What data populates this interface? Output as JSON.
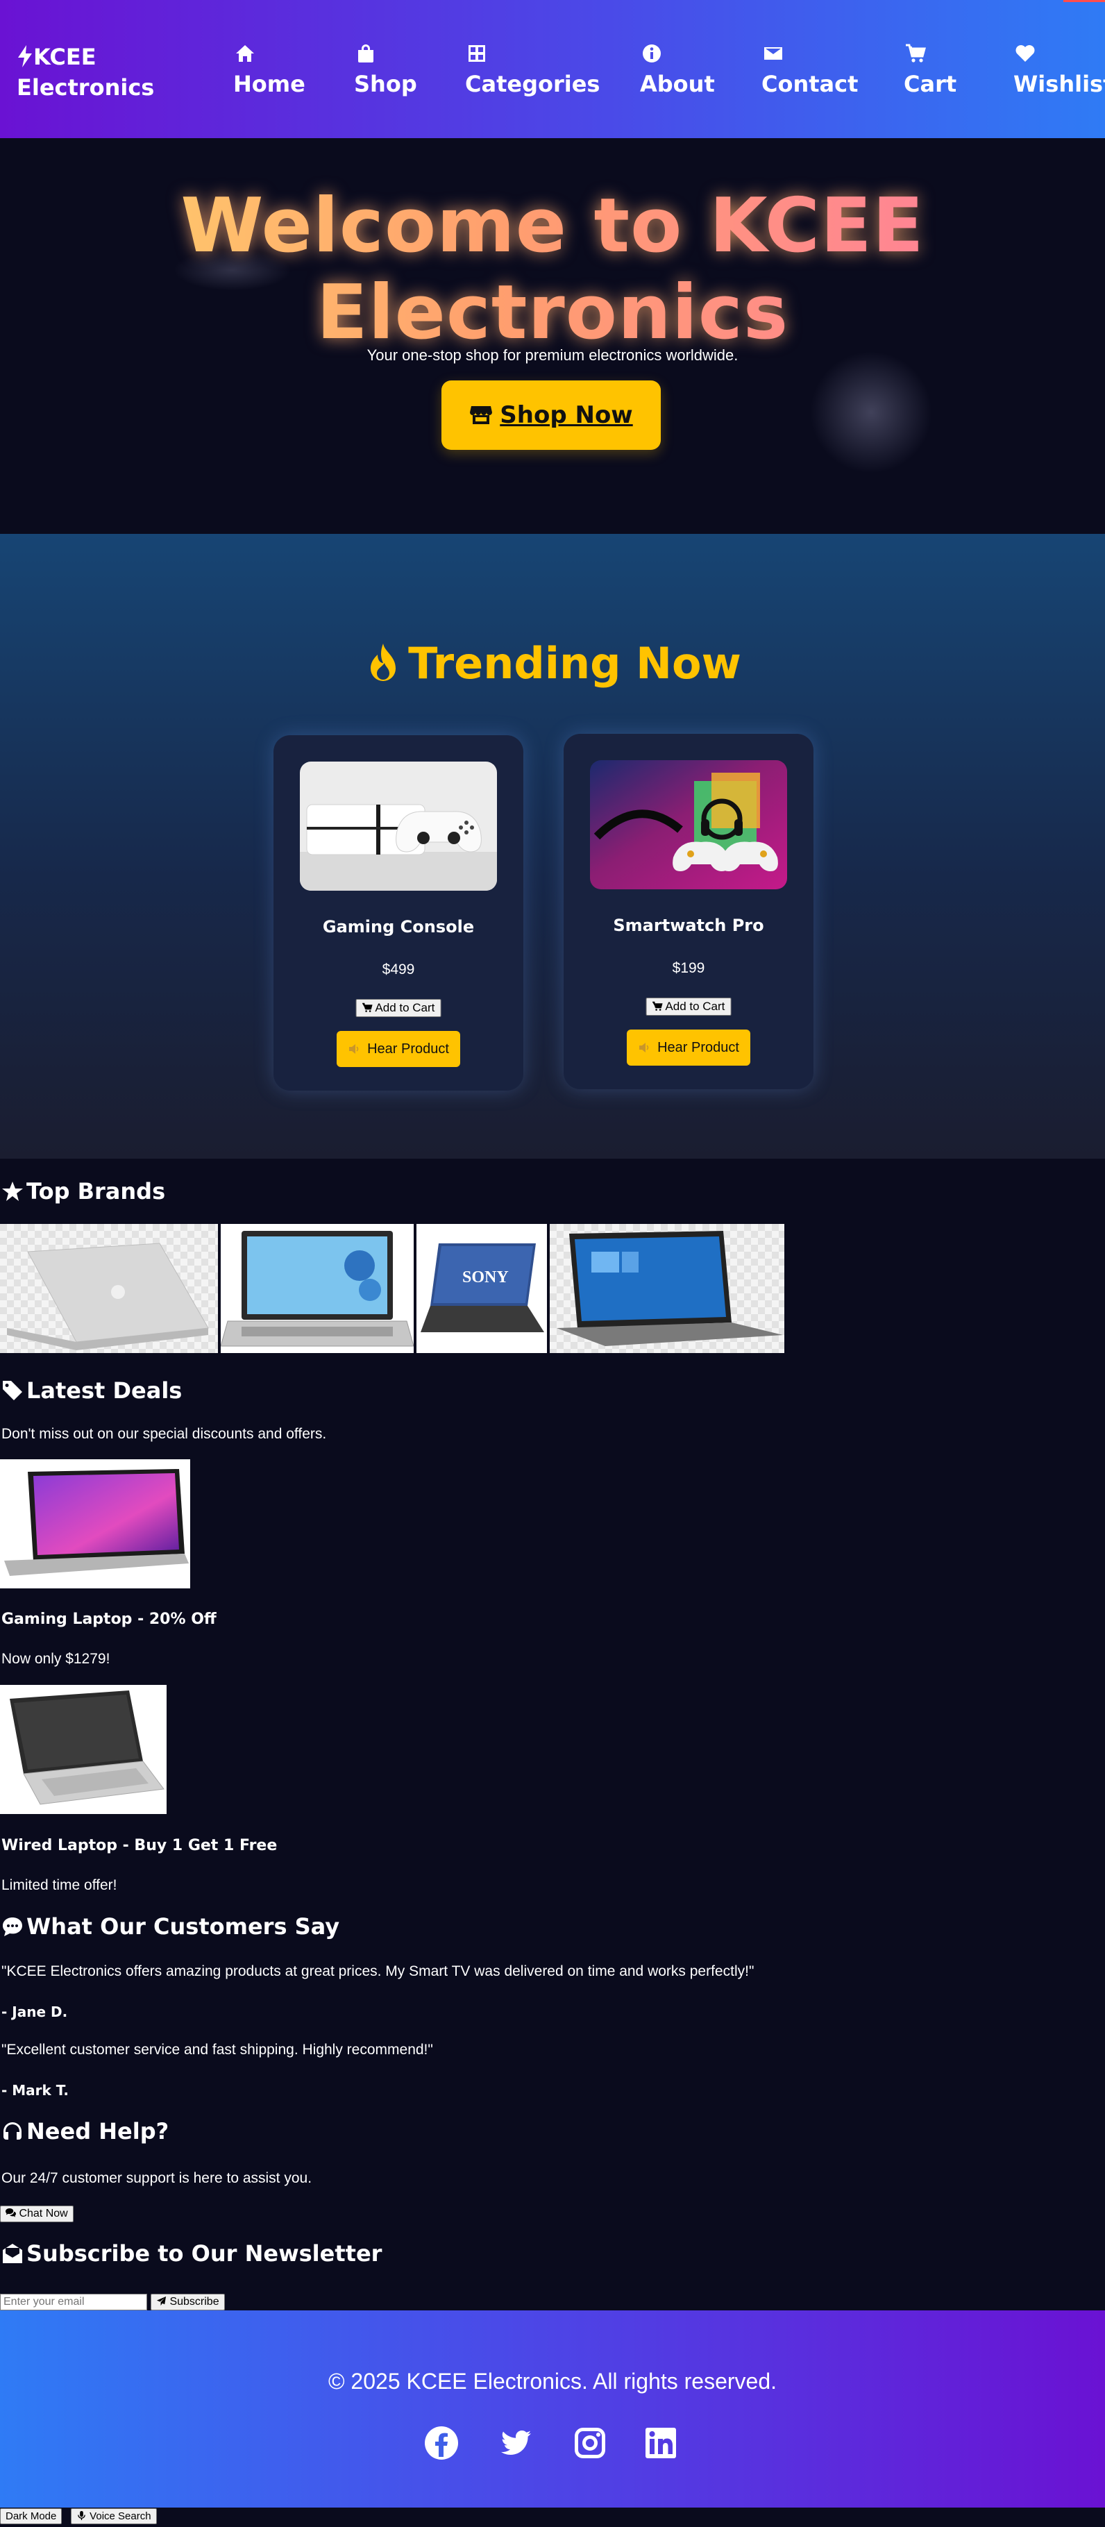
{
  "nav": {
    "brand_line1": "KCEE",
    "brand_line2": "Electronics",
    "items": [
      {
        "label": "Home",
        "icon": "home-icon"
      },
      {
        "label": "Shop",
        "icon": "shopping-bag-icon"
      },
      {
        "label": "Categories",
        "icon": "grid-icon"
      },
      {
        "label": "About",
        "icon": "info-icon"
      },
      {
        "label": "Contact",
        "icon": "envelope-icon"
      },
      {
        "label": "Cart",
        "icon": "cart-icon"
      },
      {
        "label": "Wishlist",
        "icon": "heart-icon"
      }
    ]
  },
  "hero": {
    "title": "Welcome to KCEE Electronics",
    "subtitle": "Your one-stop shop for premium electronics worldwide.",
    "cta": "Shop Now"
  },
  "trending": {
    "title": "Trending Now",
    "products": [
      {
        "name": "Gaming Console",
        "price": "$499",
        "add_label": "Add to Cart",
        "hear_label": "Hear Product"
      },
      {
        "name": "Smartwatch Pro",
        "price": "$199",
        "add_label": "Add to Cart",
        "hear_label": "Hear Product"
      }
    ]
  },
  "brands": {
    "title": "Top Brands",
    "logo_texts": [
      "SONY"
    ]
  },
  "deals": {
    "title": "Latest Deals",
    "intro": "Don't miss out on our special discounts and offers.",
    "items": [
      {
        "title": "Gaming Laptop - 20% Off",
        "desc": "Now only $1279!"
      },
      {
        "title": "Wired Laptop - Buy 1 Get 1 Free",
        "desc": "Limited time offer!"
      }
    ]
  },
  "testimonials": {
    "title": "What Our Customers Say",
    "items": [
      {
        "quote": "\"KCEE Electronics offers amazing products at great prices. My Smart TV was delivered on time and works perfectly!\"",
        "author": "- Jane D."
      },
      {
        "quote": "\"Excellent customer service and fast shipping. Highly recommend!\"",
        "author": "- Mark T."
      }
    ]
  },
  "help": {
    "title": "Need Help?",
    "text": "Our 24/7 customer support is here to assist you.",
    "button": "Chat Now"
  },
  "newsletter": {
    "title": "Subscribe to Our Newsletter",
    "placeholder": "Enter your email",
    "button": "Subscribe"
  },
  "footer": {
    "copyright": "© 2025 KCEE Electronics. All rights reserved.",
    "social": [
      "facebook-icon",
      "twitter-icon",
      "instagram-icon",
      "linkedin-icon"
    ]
  },
  "fixed_buttons": {
    "dark_mode": "Dark Mode",
    "voice_search": "Voice Search"
  },
  "colors": {
    "accent": "#ffc300",
    "background": "#0a0b1d",
    "nav_gradient_start": "#6a12d3",
    "nav_gradient_end": "#2f7bf5"
  }
}
